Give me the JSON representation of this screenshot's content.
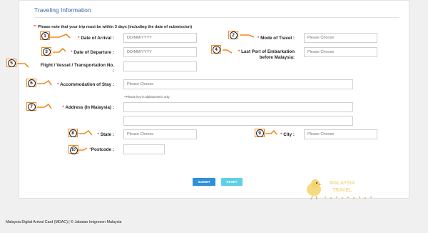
{
  "section": {
    "title": "Traveling Information",
    "note_marker": "**",
    "note": "Please note that your trip must be within 3 days (including the date of submission)"
  },
  "fields": {
    "date_of_arrival": {
      "label": "Date of Arrival :",
      "required": "*",
      "placeholder": "DD/MM/YYYY",
      "badge": "1"
    },
    "mode_of_travel": {
      "label": "Mode of Travel :",
      "required": "*",
      "value": "Please Choose",
      "badge": "2"
    },
    "date_of_departure": {
      "label": "Date of Departure :",
      "required": "*",
      "placeholder": "DD/MM/YYYY",
      "badge": "3"
    },
    "last_port": {
      "label_line1": "Last Port of Embarkation",
      "label_line2": "before Malaysia:",
      "required": "*",
      "value": "Please Choose",
      "badge": "4"
    },
    "flight": {
      "label_line1": "Flight / Vessel / Transportation No.",
      "label_line2": ":",
      "value": "",
      "badge": "5"
    },
    "accommodation": {
      "label": "Accommodation of Stay :",
      "required": "*",
      "value": "Please Choose",
      "badge": "6"
    },
    "address": {
      "label": "Address (In Malaysia) :",
      "required": "*",
      "hint": "**Please key-in alphanumeric only",
      "line1": "",
      "line2": "",
      "badge": "7"
    },
    "state": {
      "label": "State :",
      "required": "*",
      "value": "Please Choose",
      "badge": "8"
    },
    "city": {
      "label": "City :",
      "required": "*",
      "value": "Please Choose",
      "badge": "9"
    },
    "postcode": {
      "label": "Postcode :",
      "required": "*",
      "value": "",
      "badge": "10"
    }
  },
  "buttons": {
    "submit": "SUBMIT",
    "reset": "RESET"
  },
  "watermark": {
    "line1": "MALAYSIA",
    "line2": "TRAVEL"
  },
  "footer": "Malaysia Digital Arrival Card (MDAC) | © Jabatan Imigresen Malaysia",
  "colors": {
    "accent": "#f08a24",
    "title": "#3f63a8",
    "submit": "#2f8fd8",
    "reset": "#5fd0e6",
    "required": "#e74c3c"
  }
}
